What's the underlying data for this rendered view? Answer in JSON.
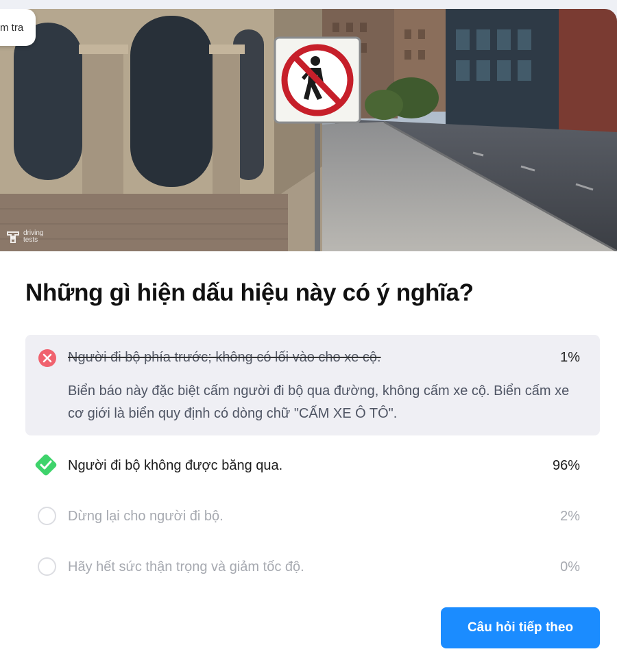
{
  "header": {
    "badge_label": "m tra"
  },
  "image": {
    "watermark_text": "driving tests"
  },
  "question": {
    "text": "Những gì hiện dấu hiệu này có ý nghĩa?"
  },
  "answers": [
    {
      "text": "Người đi bộ phía trước; không có lối vào cho xe cộ.",
      "percent": "1%",
      "state": "wrong",
      "explanation": "Biển báo này đặc biệt cấm người đi bộ qua đường, không cấm xe cộ. Biển cấm xe cơ giới là biển quy định có dòng chữ \"CẤM XE Ô TÔ\"."
    },
    {
      "text": "Người đi bộ không được băng qua.",
      "percent": "96%",
      "state": "correct"
    },
    {
      "text": "Dừng lại cho người đi bộ.",
      "percent": "2%",
      "state": "unselected"
    },
    {
      "text": "Hãy hết sức thận trọng và giảm tốc độ.",
      "percent": "0%",
      "state": "unselected"
    }
  ],
  "actions": {
    "next_label": "Câu hỏi tiếp theo"
  },
  "colors": {
    "primary": "#1b8cff",
    "wrong": "#f0626e",
    "correct": "#3ed36b",
    "sign_red": "#c61f2a"
  }
}
